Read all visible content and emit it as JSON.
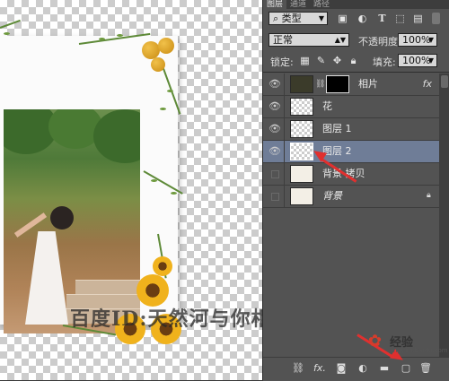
{
  "panel": {
    "tabs": [
      "图层",
      "通道",
      "路径"
    ],
    "filter_kind": "类型",
    "blend_mode": "正常",
    "opacity_label": "不透明度:",
    "opacity_value": "100%",
    "lock_label": "锁定:",
    "fill_label": "填充:",
    "fill_value": "100%",
    "filter_icons": [
      "image-filter-icon",
      "adjustment-filter-icon",
      "type-filter-icon",
      "shape-filter-icon",
      "smart-object-filter-icon"
    ],
    "lock_icons": [
      "lock-transparent-icon",
      "lock-pixels-icon",
      "lock-position-icon",
      "lock-all-icon"
    ],
    "bottom_icons": [
      "link-icon",
      "fx-icon",
      "mask-icon",
      "adjustment-icon",
      "group-icon",
      "new-layer-icon",
      "trash-icon"
    ]
  },
  "layers": [
    {
      "name": "相片",
      "visible": true,
      "selected": false,
      "has_mask": true,
      "fx": "fx",
      "locked": false,
      "italic": false
    },
    {
      "name": "花",
      "visible": true,
      "selected": false,
      "has_mask": false,
      "fx": "",
      "locked": false,
      "italic": false
    },
    {
      "name": "图层 1",
      "visible": true,
      "selected": false,
      "has_mask": false,
      "fx": "",
      "locked": false,
      "italic": false
    },
    {
      "name": "图层 2",
      "visible": true,
      "selected": true,
      "has_mask": false,
      "fx": "",
      "locked": false,
      "italic": false
    },
    {
      "name": "背景 拷贝",
      "visible": false,
      "selected": false,
      "has_mask": false,
      "fx": "",
      "locked": false,
      "italic": false
    },
    {
      "name": "背景",
      "visible": false,
      "selected": false,
      "has_mask": false,
      "fx": "",
      "locked": true,
      "italic": true
    }
  ],
  "canvas": {
    "watermark": "百度ID:天然河与你相约"
  },
  "logo": {
    "text": "经验",
    "sub": "jingyan.baidu.com"
  },
  "colors": {
    "selection": "#6f7d97",
    "annotation": "#e0302f",
    "panel_bg": "#535353"
  }
}
